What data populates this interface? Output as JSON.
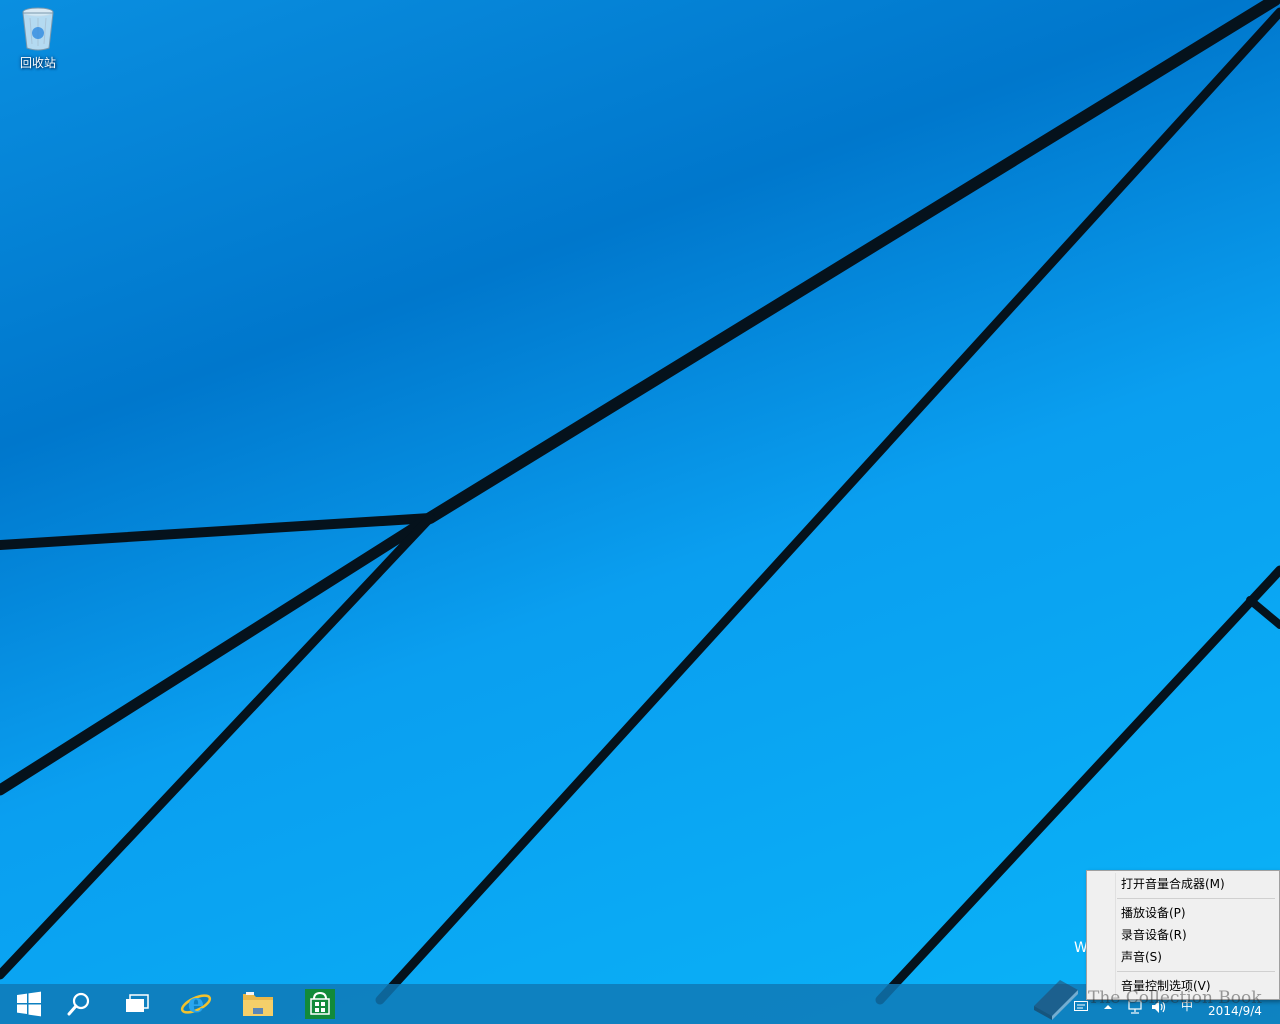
{
  "desktop": {
    "icons": [
      {
        "label": "回收站",
        "icon": "recycle-bin-icon"
      }
    ],
    "partial_text": "W"
  },
  "taskbar": {
    "buttons": [
      {
        "name": "start",
        "icon": "windows-logo-icon"
      },
      {
        "name": "search",
        "icon": "search-icon"
      },
      {
        "name": "task-view",
        "icon": "task-view-icon"
      },
      {
        "name": "internet-explorer",
        "icon": "internet-explorer-icon"
      },
      {
        "name": "file-explorer",
        "icon": "folder-icon"
      },
      {
        "name": "store",
        "icon": "store-icon"
      }
    ],
    "tray": {
      "input_method": "中",
      "date": "2014/9/4"
    }
  },
  "context_menu": {
    "items": [
      {
        "label": "打开音量合成器(M)"
      },
      {
        "label": "播放设备(P)"
      },
      {
        "label": "录音设备(R)"
      },
      {
        "label": "声音(S)"
      },
      {
        "label": "音量控制选项(V)"
      }
    ]
  },
  "watermark": {
    "text": "The Collection Book"
  },
  "colors": {
    "accent": "#0a9ff0",
    "taskbar": "#1078b4",
    "store_green": "#128a3a"
  }
}
